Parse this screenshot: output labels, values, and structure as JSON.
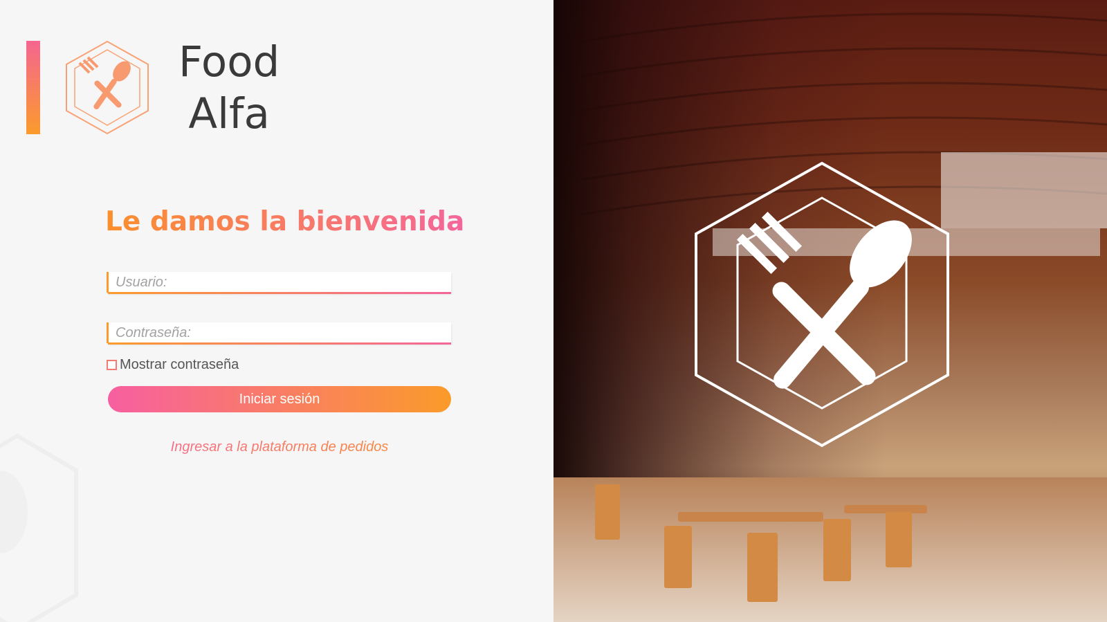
{
  "brand": {
    "line1": "Food",
    "line2": "Alfa"
  },
  "welcome_title": "Le damos la bienvenida",
  "form": {
    "username_placeholder": "Usuario:",
    "password_placeholder": "Contraseña:",
    "show_password_label": "Mostrar contraseña",
    "login_button": "Iniciar sesión",
    "platform_link": "Ingresar a la plataforma de pedidos"
  },
  "icons": {
    "logo": "fork-spoon-hexagon-icon",
    "hero_logo": "fork-spoon-hexagon-icon"
  },
  "colors": {
    "accent_orange": "#fb9b2d",
    "accent_pink": "#f4669b",
    "text_dark": "#3a3a3a",
    "background": "#f6f6f6"
  }
}
